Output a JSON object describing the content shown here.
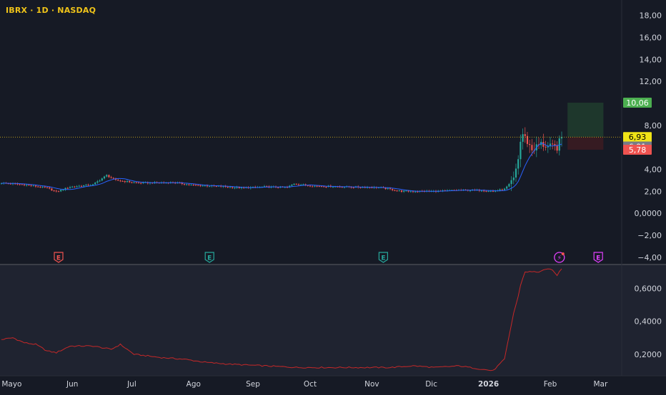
{
  "header": {
    "symbol": "IBRX · 1D · NASDAQ"
  },
  "colors": {
    "background": "#161a25",
    "bull": "#26a69a",
    "bear": "#ef5350",
    "ma_line": "#2962ff",
    "indicator_line": "#c62828",
    "axis_text": "#d1d4dc",
    "separator": "#3b3e47",
    "price_line": "#f0c419",
    "target_zone": "#1f3b2e",
    "stop_zone": "#3a1c22"
  },
  "price_axis": {
    "labels": [
      "18,00",
      "16,00",
      "14,00",
      "12,00",
      "8,00",
      "4,00",
      "2,00",
      "0,0000",
      "−2,00",
      "−4,00"
    ],
    "values": [
      18,
      16,
      14,
      12,
      8,
      4,
      2,
      0,
      -2,
      -4
    ]
  },
  "price_tags": [
    {
      "label": "10,06",
      "value": 10.06,
      "color": "#4caf50",
      "text_color": "#ffffff"
    },
    {
      "label": "6,93",
      "value": 6.93,
      "color": "#f0e417",
      "text_color": "#000000"
    },
    {
      "label": "6,91",
      "value": 6.91,
      "color": "#787b86",
      "text_color": "#ffffff"
    },
    {
      "label": "5,78",
      "value": 5.78,
      "color": "#ef5350",
      "text_color": "#ffffff"
    }
  ],
  "indicator_axis": {
    "labels": [
      "0,6000",
      "0,4000",
      "0,2000"
    ],
    "values": [
      0.6,
      0.4,
      0.2
    ]
  },
  "time_axis": {
    "labels": [
      "Mayo",
      "Jun",
      "Jul",
      "Ago",
      "Sep",
      "Oct",
      "Nov",
      "Dic",
      "2026",
      "Feb",
      "Mar"
    ],
    "positions": [
      4.5,
      31,
      57,
      84,
      110,
      135,
      162,
      188,
      213,
      240,
      262
    ]
  },
  "events": [
    {
      "icon": "earnings-icon",
      "label": "E",
      "index": 25,
      "color": "#ef5350"
    },
    {
      "icon": "earnings-icon",
      "label": "E",
      "index": 91,
      "color": "#26a69a"
    },
    {
      "icon": "earnings-icon",
      "label": "E",
      "index": 167,
      "color": "#26a69a"
    },
    {
      "icon": "flash-icon",
      "label": "⚡",
      "index": 244,
      "color": "#e040fb"
    },
    {
      "icon": "earnings-icon",
      "label": "E",
      "index": 261,
      "color": "#e040fb"
    }
  ],
  "chart_data": {
    "type": "candlestick",
    "symbol": "IBRX",
    "interval": "1D",
    "exchange": "NASDAQ",
    "ylim": [
      -4.6,
      19.4
    ],
    "indicator_ylim": [
      0.07,
      0.74
    ],
    "current_price": 6.93,
    "position": {
      "target": 10.06,
      "entry": 6.93,
      "stop": 5.78,
      "start_index": 246,
      "end_index": 262
    },
    "price_keyframes": [
      [
        0,
        2.75
      ],
      [
        10,
        2.6
      ],
      [
        20,
        2.3
      ],
      [
        24,
        1.95
      ],
      [
        30,
        2.4
      ],
      [
        40,
        2.6
      ],
      [
        46,
        3.45
      ],
      [
        50,
        3.0
      ],
      [
        60,
        2.75
      ],
      [
        75,
        2.8
      ],
      [
        84,
        2.55
      ],
      [
        95,
        2.45
      ],
      [
        105,
        2.3
      ],
      [
        115,
        2.4
      ],
      [
        125,
        2.35
      ],
      [
        128,
        2.7
      ],
      [
        135,
        2.5
      ],
      [
        150,
        2.4
      ],
      [
        165,
        2.35
      ],
      [
        175,
        2.0
      ],
      [
        190,
        2.0
      ],
      [
        200,
        2.1
      ],
      [
        210,
        2.1
      ],
      [
        215,
        2.0
      ],
      [
        220,
        2.2
      ],
      [
        224,
        3.0
      ],
      [
        226,
        5.0
      ],
      [
        227,
        6.5
      ],
      [
        228,
        7.2
      ],
      [
        230,
        6.5
      ],
      [
        232,
        5.8
      ],
      [
        236,
        6.3
      ],
      [
        240,
        6.0
      ],
      [
        243,
        6.0
      ],
      [
        245,
        6.93
      ]
    ],
    "indicator_keyframes": [
      [
        0,
        0.29
      ],
      [
        5,
        0.3
      ],
      [
        10,
        0.27
      ],
      [
        15,
        0.26
      ],
      [
        20,
        0.22
      ],
      [
        24,
        0.21
      ],
      [
        30,
        0.25
      ],
      [
        40,
        0.25
      ],
      [
        48,
        0.23
      ],
      [
        52,
        0.26
      ],
      [
        58,
        0.2
      ],
      [
        70,
        0.18
      ],
      [
        80,
        0.17
      ],
      [
        90,
        0.15
      ],
      [
        100,
        0.14
      ],
      [
        115,
        0.13
      ],
      [
        130,
        0.12
      ],
      [
        150,
        0.12
      ],
      [
        170,
        0.12
      ],
      [
        180,
        0.13
      ],
      [
        190,
        0.12
      ],
      [
        200,
        0.13
      ],
      [
        210,
        0.11
      ],
      [
        215,
        0.1
      ],
      [
        220,
        0.17
      ],
      [
        224,
        0.45
      ],
      [
        226,
        0.55
      ],
      [
        227,
        0.62
      ],
      [
        229,
        0.7
      ],
      [
        235,
        0.7
      ],
      [
        240,
        0.72
      ],
      [
        243,
        0.68
      ],
      [
        245,
        0.72
      ]
    ]
  }
}
